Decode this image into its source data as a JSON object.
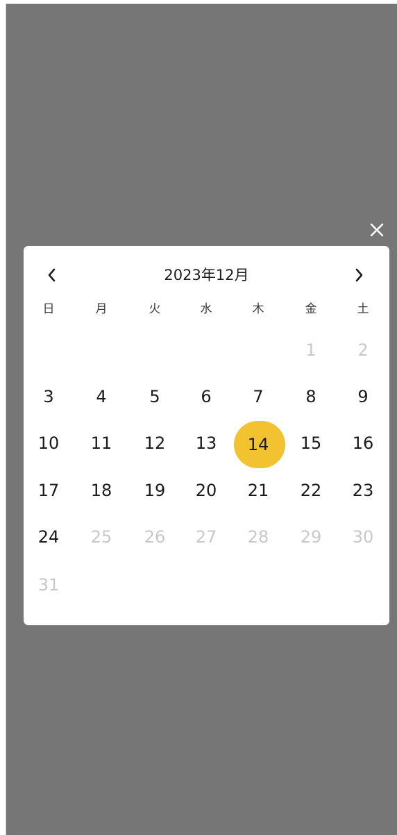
{
  "calendar": {
    "title": "2023年12月",
    "weekdays": [
      "日",
      "月",
      "火",
      "水",
      "木",
      "金",
      "土"
    ],
    "rows": [
      [
        null,
        null,
        null,
        null,
        null,
        "1",
        "2"
      ],
      [
        "3",
        "4",
        "5",
        "6",
        "7",
        "8",
        "9"
      ],
      [
        "10",
        "11",
        "12",
        "13",
        "14",
        "15",
        "16"
      ],
      [
        "17",
        "18",
        "19",
        "20",
        "21",
        "22",
        "23"
      ],
      [
        "24",
        "25",
        "26",
        "27",
        "28",
        "29",
        "30"
      ],
      [
        "31",
        null,
        null,
        null,
        null,
        null,
        null
      ]
    ],
    "muted_days": [
      "1",
      "2",
      "25",
      "26",
      "27",
      "28",
      "29",
      "30",
      "31"
    ],
    "selected_day": "14",
    "selected_color": "#f2c230"
  },
  "icons": {
    "close": "close-icon",
    "prev": "chevron-left-icon",
    "next": "chevron-right-icon"
  }
}
